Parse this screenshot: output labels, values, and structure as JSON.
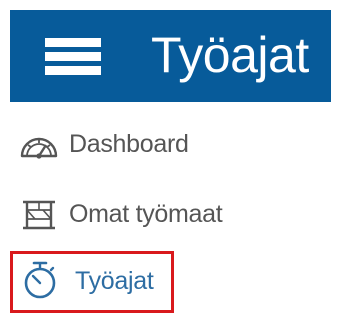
{
  "header": {
    "title": "Työajat",
    "background_color": "#075b9a",
    "menu_icon": "hamburger-menu-icon"
  },
  "nav": {
    "items": [
      {
        "label": "Dashboard",
        "icon": "speedometer-icon"
      },
      {
        "label": "Omat työmaat",
        "icon": "construction-crane-icon"
      },
      {
        "label": "Työajat",
        "icon": "stopwatch-icon",
        "highlighted": true,
        "highlight_color": "#d9191c"
      }
    ]
  }
}
